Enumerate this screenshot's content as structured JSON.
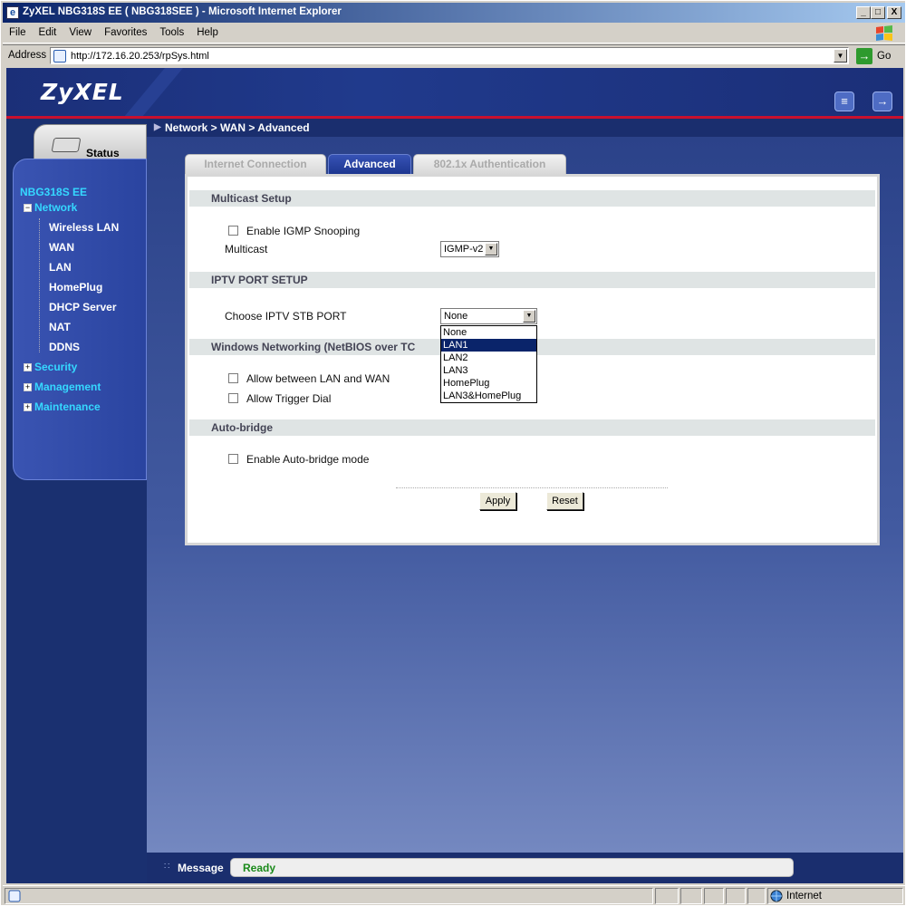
{
  "window": {
    "title": "ZyXEL NBG318S EE ( NBG318SEE ) - Microsoft Internet Explorer",
    "minimize": "_",
    "maximize": "□",
    "close": "X"
  },
  "menu": [
    "File",
    "Edit",
    "View",
    "Favorites",
    "Tools",
    "Help"
  ],
  "address": {
    "label": "Address",
    "url": "http://172.16.20.253/rpSys.html",
    "go_label": "Go"
  },
  "brand": {
    "logo": "ZyXEL"
  },
  "breadcrumb": "Network > WAN > Advanced",
  "status_tab": "Status",
  "nav": {
    "device": "NBG318S EE",
    "network": "Network",
    "network_items": [
      "Wireless LAN",
      "WAN",
      "LAN",
      "HomePlug",
      "DHCP Server",
      "NAT",
      "DDNS"
    ],
    "security": "Security",
    "management": "Management",
    "maintenance": "Maintenance"
  },
  "tabs": [
    "Internet Connection",
    "Advanced",
    "802.1x Authentication"
  ],
  "sections": {
    "multicast": {
      "title": "Multicast Setup",
      "igmp_label": "Enable IGMP Snooping",
      "multicast_label": "Multicast",
      "multicast_value": "IGMP-v2"
    },
    "iptv": {
      "title": "IPTV PORT SETUP",
      "port_label": "Choose IPTV STB PORT",
      "port_value": "None",
      "options": [
        "None",
        "LAN1",
        "LAN2",
        "LAN3",
        "HomePlug",
        "LAN3&HomePlug"
      ],
      "highlighted": "LAN1"
    },
    "netbios": {
      "title": "Windows Networking (NetBIOS over TC",
      "allow_lan_wan": "Allow between LAN and WAN",
      "allow_trigger": "Allow Trigger Dial"
    },
    "autobridge": {
      "title": "Auto-bridge",
      "enable_label": "Enable Auto-bridge mode"
    }
  },
  "buttons": {
    "apply": "Apply",
    "reset": "Reset"
  },
  "message": {
    "label": "Message",
    "value": "Ready"
  },
  "statusbar": {
    "zone": "Internet"
  },
  "colors": {
    "brand_blue": "#2c4590",
    "accent_red": "#c8102e",
    "nav_cyan": "#35d8ff",
    "ready_green": "#1a8a1a"
  }
}
